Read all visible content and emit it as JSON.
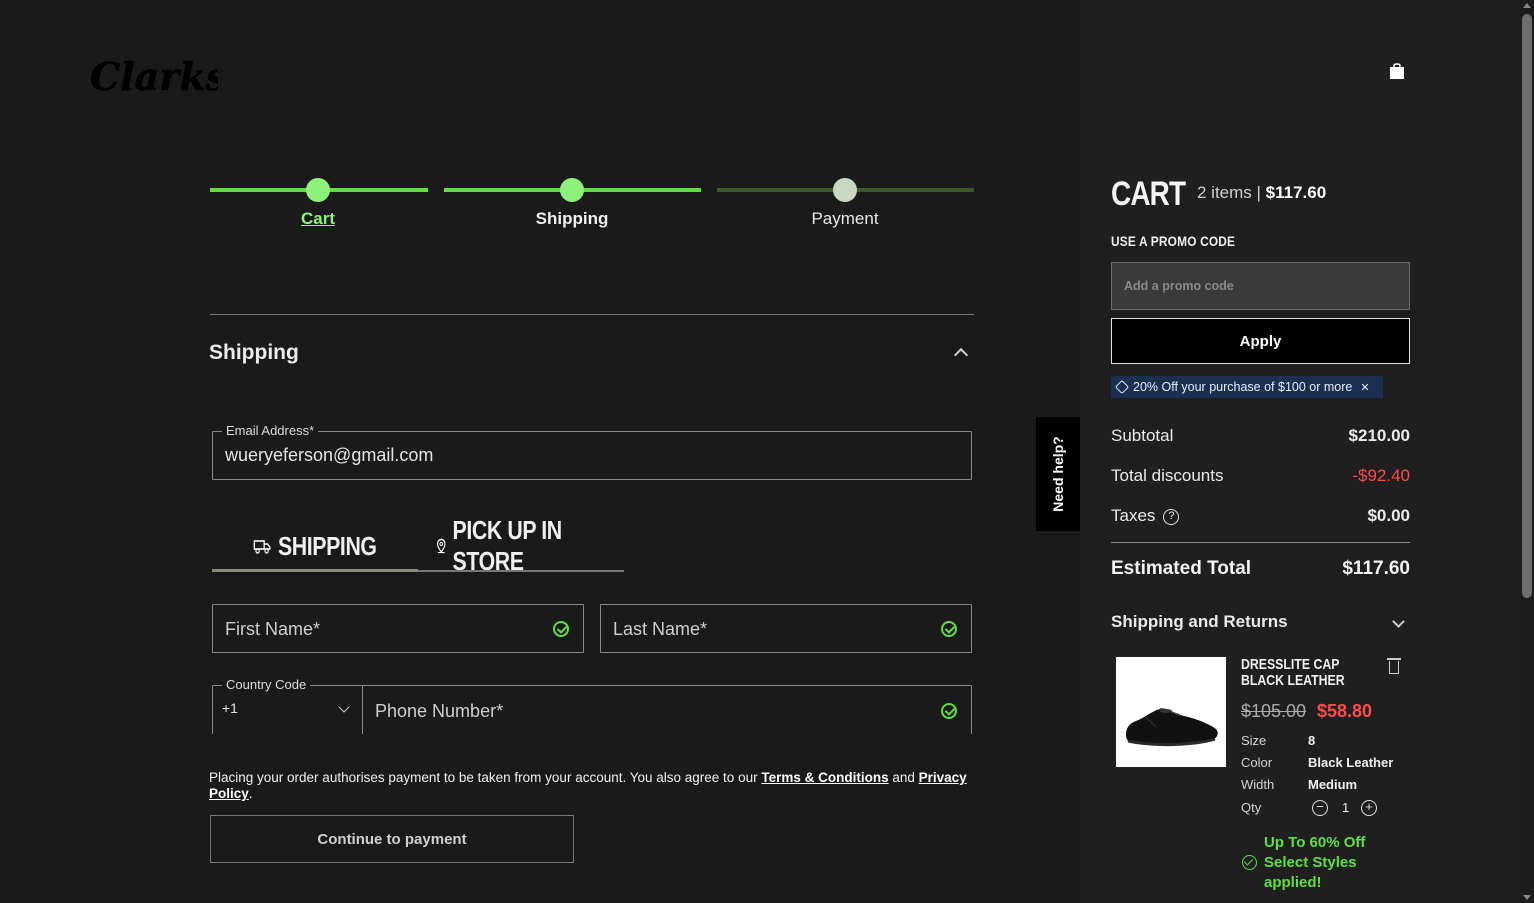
{
  "brand": {
    "logo_text": "Clarks"
  },
  "steps": [
    {
      "label": "Cart",
      "state": "done"
    },
    {
      "label": "Shipping",
      "state": "current"
    },
    {
      "label": "Payment",
      "state": "pending"
    }
  ],
  "section": {
    "title": "Shipping"
  },
  "email": {
    "label": "Email Address*",
    "value": "wueryeferson@gmail.com"
  },
  "tabs": [
    {
      "label": "SHIPPING",
      "icon": "truck-icon",
      "active": true
    },
    {
      "label": "PICK UP IN STORE",
      "icon": "location-pin-icon",
      "active": false
    }
  ],
  "form": {
    "first_name_placeholder": "First Name*",
    "last_name_placeholder": "Last Name*",
    "country_code_label": "Country Code",
    "country_code_value": "+1",
    "phone_placeholder": "Phone Number*"
  },
  "legal": {
    "text_before": "Placing your order authorises payment to be taken from your account. You also agree to our ",
    "terms_link": "Terms & Conditions",
    "text_and": " and ",
    "privacy_link": "Privacy Policy",
    "text_end": "."
  },
  "continue_button": "Continue to payment",
  "help_tab": "Need help?",
  "cart": {
    "title": "CART",
    "items_text": "2 items | ",
    "items_total": "$117.60",
    "promo_label": "USE A PROMO CODE",
    "promo_placeholder": "Add a promo code",
    "apply_label": "Apply",
    "promo_applied": "20% Off your purchase of $100 or more",
    "subtotal_label": "Subtotal",
    "subtotal_value": "$210.00",
    "discount_label": "Total discounts",
    "discount_value": "-$92.40",
    "taxes_label": "Taxes",
    "taxes_value": "$0.00",
    "estimated_label": "Estimated Total",
    "estimated_value": "$117.60",
    "shipping_returns": "Shipping and Returns",
    "item": {
      "name": "DRESSLITE CAP BLACK LEATHER",
      "old_price": "$105.00",
      "new_price": "$58.80",
      "size_label": "Size",
      "size_value": "8",
      "color_label": "Color",
      "color_value": "Black Leather",
      "width_label": "Width",
      "width_value": "Medium",
      "qty_label": "Qty",
      "qty_value": "1",
      "offer": "Up To 60% Off Select Styles applied!"
    }
  },
  "colors": {
    "accent_green": "#5ee040",
    "discount_red": "#ff4b4b",
    "promo_tag_bg": "#1b3050"
  }
}
